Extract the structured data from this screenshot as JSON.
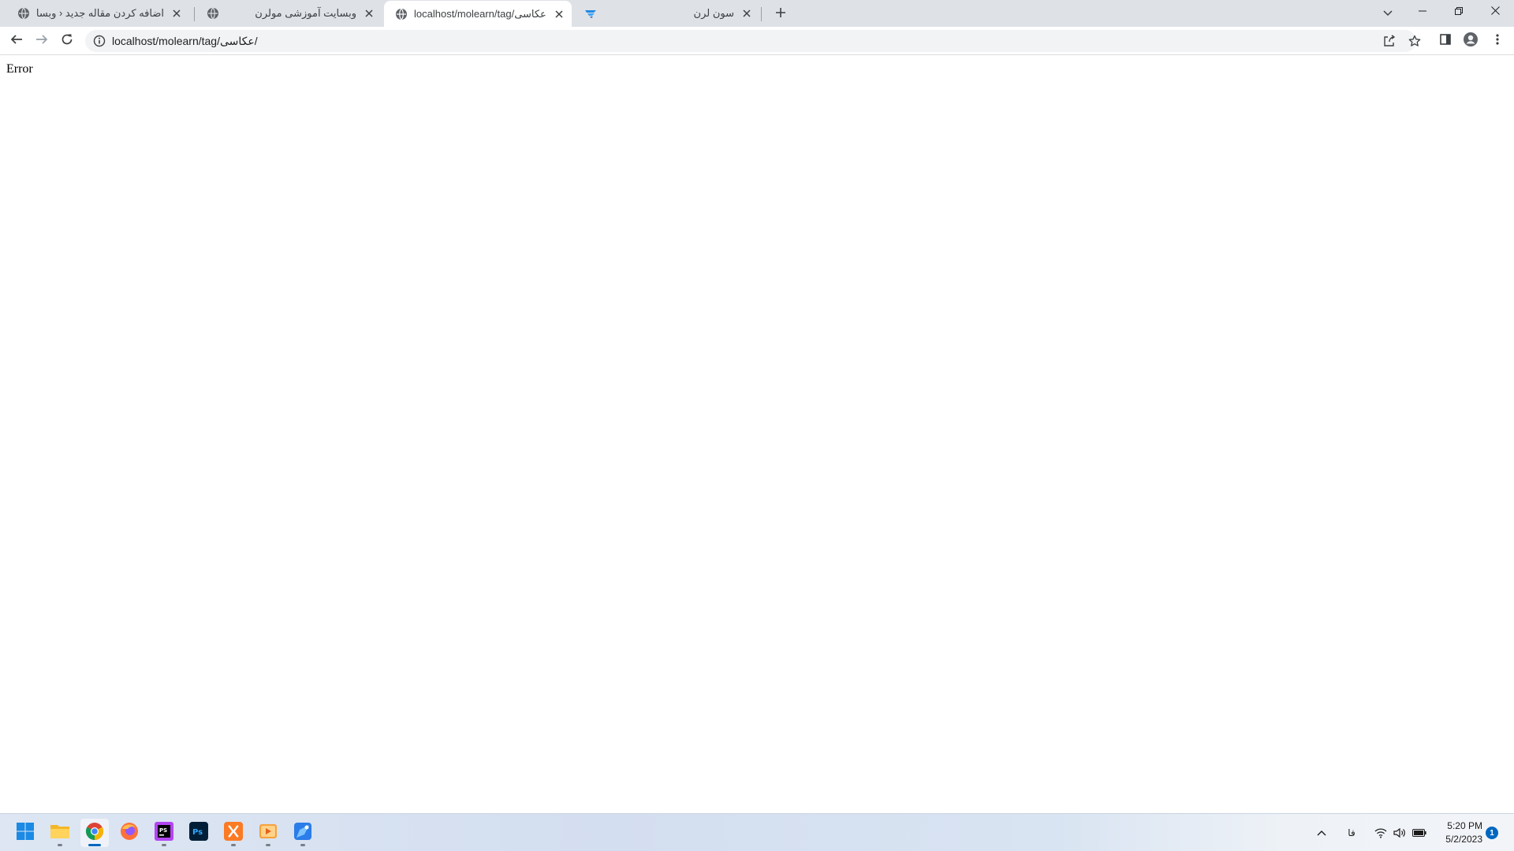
{
  "browser": {
    "tabs": [
      {
        "title": "اضافه کردن مقاله جدید ‹ وبسایت آموزشی مولرن",
        "favicon": "globe-icon",
        "active": false
      },
      {
        "title": "وبسایت آموزشی مولرن",
        "favicon": "globe-icon",
        "active": false
      },
      {
        "title": "localhost/molearn/tag/عکاسی/",
        "favicon": "globe-icon",
        "active": true
      },
      {
        "title": "سون لرن",
        "favicon": "sevenlearn-logo-icon",
        "active": false
      }
    ],
    "new_tab_icon": "plus-icon",
    "tab_search_icon": "chevron-down-icon",
    "window_controls": [
      "minimize-icon",
      "restore-icon",
      "close-icon"
    ]
  },
  "toolbar": {
    "url": "localhost/molearn/tag/عکاسی/",
    "nav_icons": [
      "back-arrow-icon",
      "forward-arrow-icon",
      "reload-icon"
    ],
    "omnibox_icons": [
      "info-icon",
      "share-icon",
      "star-icon"
    ],
    "right_icons": [
      "side-panel-icon",
      "profile-icon",
      "menu-icon"
    ]
  },
  "page": {
    "text": "Error"
  },
  "taskbar": {
    "apps": [
      "windows-start-icon",
      "file-explorer-icon",
      "chrome-icon",
      "firefox-icon",
      "phpstorm-icon",
      "photoshop-icon",
      "xampp-icon",
      "media-player-icon",
      "paint-icon"
    ],
    "tray": {
      "language": "فا",
      "time": "5:20 PM",
      "date": "5/2/2023",
      "notification_count": "1"
    }
  }
}
